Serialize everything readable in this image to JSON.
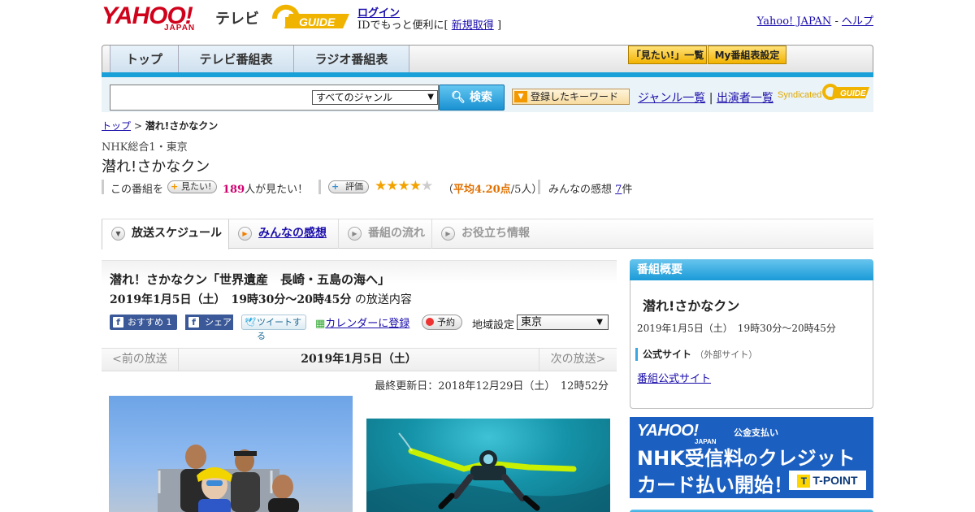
{
  "header": {
    "logo_yahoo": "YAHOO!",
    "logo_yahoo_sub": "JAPAN",
    "logo_tv": "テレビ",
    "logo_gguide": "G-GUIDE",
    "login": "ログイン",
    "login_sub_prefix": "IDでもっと便利に[",
    "signup": "新規取得",
    "login_sub_suffix": "]",
    "yahoo_japan": "Yahoo! JAPAN",
    "separator": "-",
    "help": "ヘルプ"
  },
  "nav": {
    "tabs": [
      {
        "label": "トップ"
      },
      {
        "label": "テレビ番組表"
      },
      {
        "label": "ラジオ番組表"
      }
    ],
    "mitai_list": "「見たい!」一覧",
    "my_schedule": "My番組表設定"
  },
  "search": {
    "placeholder": "",
    "genre_selected": "すべてのジャンル",
    "button": "検索",
    "keyword_button": "登録したキーワード",
    "genre_list": "ジャンル一覧",
    "link_sep": "|",
    "performer_list": "出演者一覧",
    "syndicated": "Syndicated"
  },
  "breadcrumb": {
    "top": "トップ",
    "sep": ">",
    "current": "潜れ!さかなクン"
  },
  "program": {
    "channel": "NHK総合1・東京",
    "title": "潜れ!さかなクン",
    "mitai_prefix": "この番組を",
    "mitai_button": "見たい!",
    "mitai_count": "189",
    "mitai_suffix": "人が見たい！",
    "rating_button": "評価",
    "rating_value": 4.2,
    "rating_prefix": "（",
    "rating_avg": "平均4.20点",
    "rating_suffix": "/5人）",
    "impressions_label": "みんなの感想",
    "impressions_count": "7",
    "impressions_unit": "件"
  },
  "subtabs": [
    {
      "label": "放送スケジュール"
    },
    {
      "label": "みんなの感想"
    },
    {
      "label": "番組の流れ"
    },
    {
      "label": "お役立ち情報"
    }
  ],
  "episode": {
    "title": "潜れ！さかなクン「世界遺産　長崎・五島の海へ」",
    "time": "2019年1月5日（土）　19時30分～20時45分",
    "time_suffix": "の放送内容",
    "fb_recommend": "おすすめ 1",
    "fb_share": "シェア",
    "tweet": "ツイートする",
    "calendar": "カレンダーに登録",
    "reserve": "予約",
    "region_label": "地域設定",
    "region_selected": "東京"
  },
  "datenav": {
    "prev": "<前の放送",
    "current": "2019年1月5日（土）",
    "next": "次の放送>"
  },
  "updated": "最終更新日：2018年12月29日（土）　12時52分",
  "sidebar": {
    "heading": "番組概要",
    "title": "潜れ!さかなクン",
    "time": "2019年1月5日（土）　19時30分～20時45分",
    "official_label": "公式サイト",
    "official_note": "（外部サイト）",
    "official_link": "番組公式サイト"
  },
  "ad": {
    "yahoo": "YAHOO!",
    "yahoo_sub": "JAPAN",
    "koukin": "公金支払い",
    "line1_a": "NHK受信料",
    "line1_b": "の",
    "line1_c": "クレジット",
    "line2": "カード払い開始！",
    "tpoint_mark": "T",
    "tpoint": "T-POINT"
  },
  "colors": {
    "accent_blue": "#1aa0d8",
    "yahoo_red": "#d0021b",
    "star": "#f3a200",
    "mitai_count": "#d0006f"
  }
}
